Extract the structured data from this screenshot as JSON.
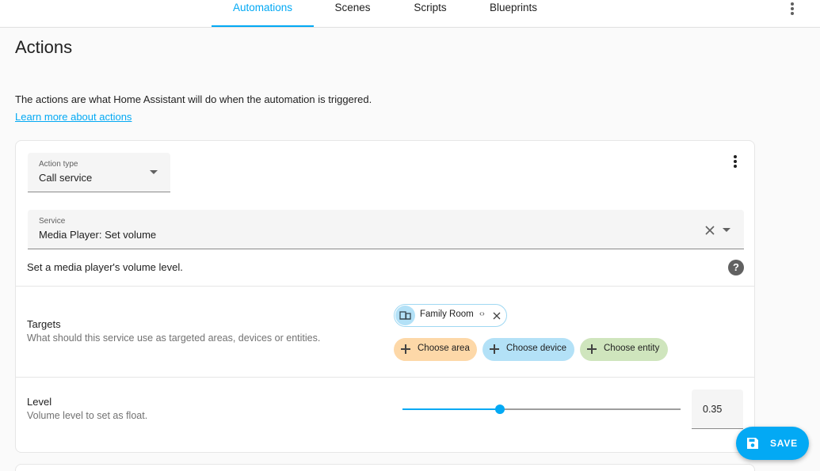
{
  "tabs": [
    {
      "label": "Automations",
      "active": true
    },
    {
      "label": "Scenes",
      "active": false
    },
    {
      "label": "Scripts",
      "active": false
    },
    {
      "label": "Blueprints",
      "active": false
    }
  ],
  "page": {
    "title": "Actions",
    "intro": "The actions are what Home Assistant will do when the automation is triggered.",
    "learn_link": "Learn more about actions"
  },
  "action": {
    "type_label": "Action type",
    "type_value": "Call service",
    "service_label": "Service",
    "service_value": "Media Player: Set volume",
    "service_description": "Set a media player's volume level.",
    "help_icon": "?"
  },
  "targets": {
    "title": "Targets",
    "description": "What should this service use as targeted areas, devices or entities.",
    "selected": [
      {
        "label": "Family Room",
        "icon": "devices-icon",
        "code": "‹›"
      }
    ],
    "add_buttons": [
      {
        "label": "Choose area",
        "color": "#fdd8a8"
      },
      {
        "label": "Choose device",
        "color": "#b3e1f7"
      },
      {
        "label": "Choose entity",
        "color": "#cfe5bd"
      }
    ]
  },
  "level": {
    "title": "Level",
    "description": "Volume level to set as float.",
    "value": "0.35",
    "fraction": 0.35
  },
  "fab": {
    "label": "SAVE",
    "icon": "floppy-disk-icon"
  },
  "colors": {
    "accent": "#03a9f4"
  }
}
